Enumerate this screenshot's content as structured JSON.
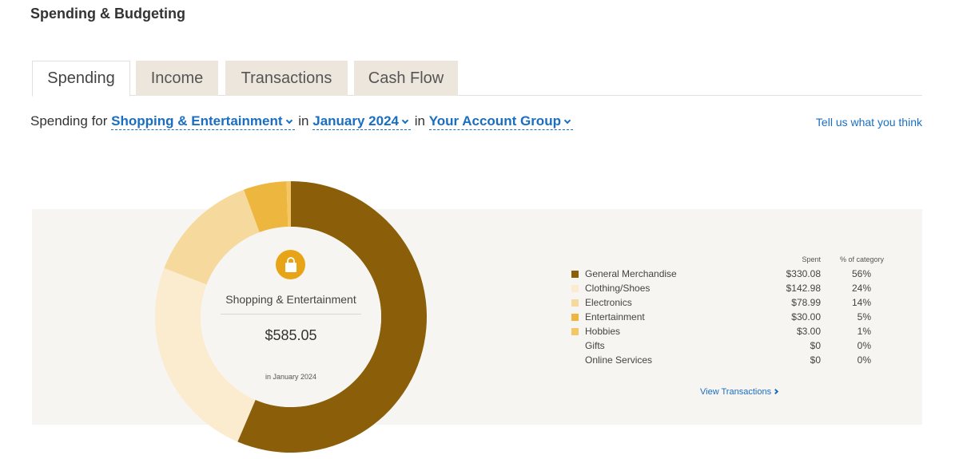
{
  "page": {
    "title": "Spending & Budgeting"
  },
  "tabs": [
    {
      "label": "Spending",
      "active": true
    },
    {
      "label": "Income",
      "active": false
    },
    {
      "label": "Transactions",
      "active": false
    },
    {
      "label": "Cash Flow",
      "active": false
    }
  ],
  "filter": {
    "prefix": "Spending for",
    "category": "Shopping & Entertainment",
    "in1": "in",
    "period": "January 2024",
    "in2": "in",
    "account": "Your Account Group",
    "feedback_link": "Tell us what you think"
  },
  "summary": {
    "icon": "shopping-bag-icon",
    "label": "Shopping & Entertainment",
    "amount": "$585.05",
    "period": "in January 2024"
  },
  "legend": {
    "header_spent": "Spent",
    "header_pct": "% of category",
    "view_transactions": "View Transactions"
  },
  "chart_data": {
    "type": "pie",
    "categories": [
      "General Merchandise",
      "Clothing/Shoes",
      "Electronics",
      "Entertainment",
      "Hobbies",
      "Gifts",
      "Online Services"
    ],
    "values": [
      330.08,
      142.98,
      78.99,
      30.0,
      3.0,
      0,
      0
    ],
    "spent_labels": [
      "$330.08",
      "$142.98",
      "$78.99",
      "$30.00",
      "$3.00",
      "$0",
      "$0"
    ],
    "percent_labels": [
      "56%",
      "24%",
      "14%",
      "5%",
      "1%",
      "0%",
      "0%"
    ],
    "colors": [
      "#8b5f0a",
      "#fbebcf",
      "#f6d99c",
      "#edb63f",
      "#f3c766",
      null,
      null
    ]
  }
}
